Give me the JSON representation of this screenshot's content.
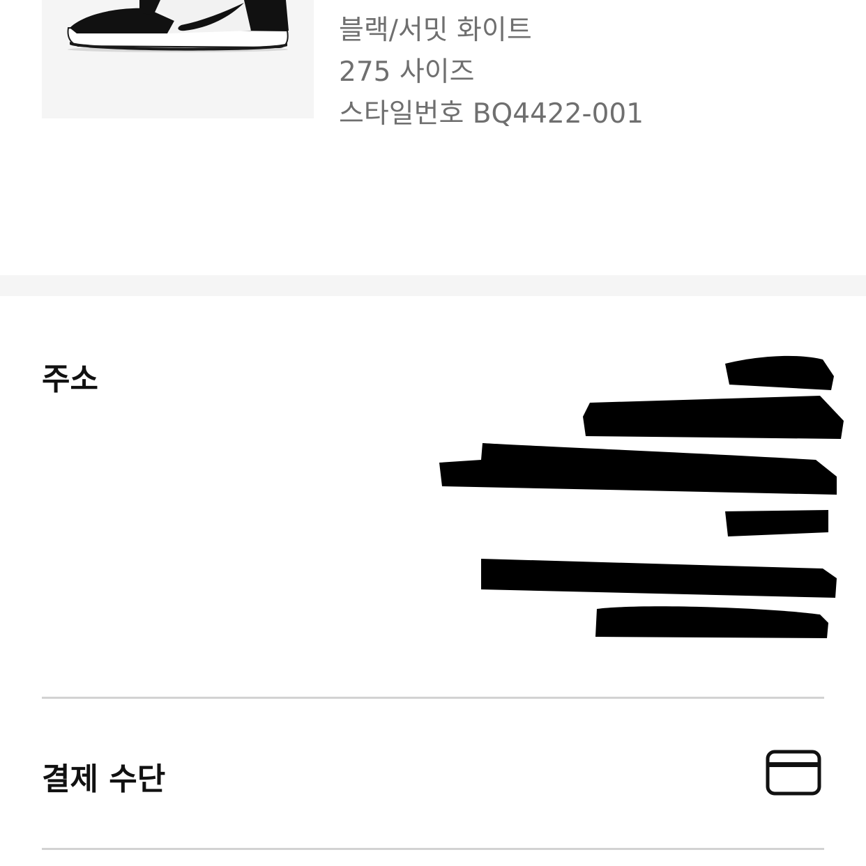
{
  "product": {
    "image_name": "sneaker-image",
    "details": [
      "블랙/서밋 화이트",
      "275 사이즈",
      "스타일번호 BQ4422-001"
    ]
  },
  "address": {
    "title": "주소",
    "lines": [
      "",
      "",
      "",
      "",
      "",
      ""
    ],
    "redaction_color": "#000000"
  },
  "payment": {
    "title": "결제 수단",
    "icon": "credit-card-icon"
  },
  "colors": {
    "text_primary": "#111111",
    "text_secondary": "#6f6f6f",
    "band": "#f5f5f5",
    "divider": "#d2d2d2"
  }
}
